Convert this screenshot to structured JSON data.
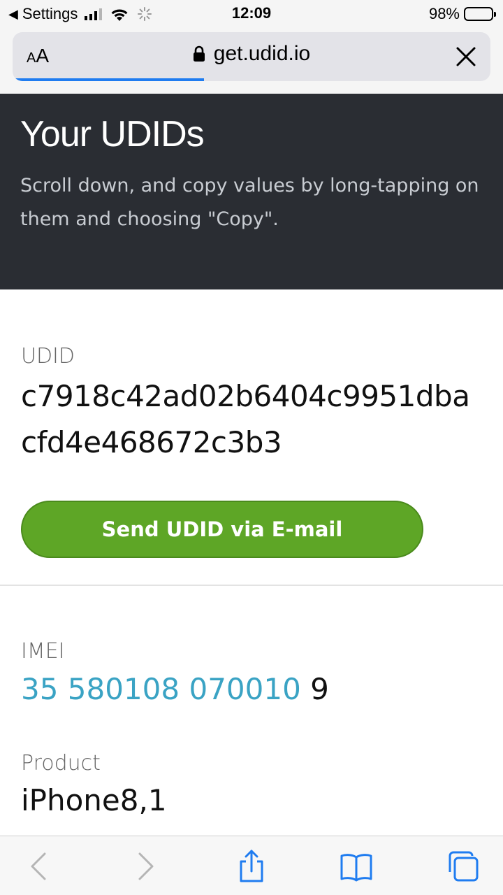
{
  "status_bar": {
    "back_app": "Settings",
    "time": "12:09",
    "battery": "98%"
  },
  "browser": {
    "aa_small": "A",
    "aa_large": "A",
    "url": "get.udid.io",
    "load_progress": 0.4,
    "icons": [
      "lock-icon",
      "close-icon"
    ]
  },
  "hero": {
    "title": "Your UDIDs",
    "subtitle": "Scroll down, and copy values by long-tapping on them and choosing \"Copy\"."
  },
  "udid": {
    "label": "UDID",
    "value": "c7918c42ad02b6404c9951dbacfd4e468672c3b3"
  },
  "send_button": "Send UDID via E-mail",
  "imei": {
    "label": "IMEI",
    "link_part": "35 580108 070010",
    "check_digit": " 9"
  },
  "product": {
    "label": "Product",
    "value": "iPhone8,1"
  },
  "toolbar": {
    "icons": [
      "back-icon",
      "forward-icon",
      "share-icon",
      "bookmarks-icon",
      "tabs-icon"
    ]
  },
  "colors": {
    "hero_bg": "#2a2d33",
    "button_green": "#5ea626",
    "link_blue": "#3aa3c4",
    "ios_blue": "#1f7cf0"
  }
}
